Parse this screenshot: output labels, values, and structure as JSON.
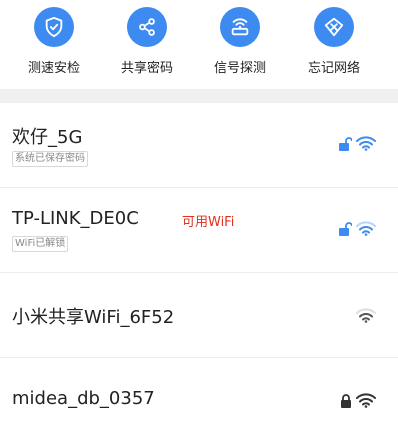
{
  "actions": [
    {
      "label": "测速安检",
      "icon": "shield-check-icon"
    },
    {
      "label": "共享密码",
      "icon": "share-icon"
    },
    {
      "label": "信号探测",
      "icon": "router-signal-icon"
    },
    {
      "label": "忘记网络",
      "icon": "tag-forget-icon"
    }
  ],
  "networks": [
    {
      "ssid": "欢仔_5G",
      "tag": "系统已保存密码",
      "hint": "",
      "lock": "open",
      "signal": "strong",
      "color": "#3d8bf0"
    },
    {
      "ssid": "TP-LINK_DE0C",
      "tag": "WiFi已解锁",
      "hint": "可用WiFi",
      "lock": "open",
      "signal": "strong",
      "color": "#3d8bf0"
    },
    {
      "ssid": "小米共享WiFi_6F52",
      "tag": "",
      "hint": "",
      "lock": "none",
      "signal": "weak",
      "color": "#555555"
    },
    {
      "ssid": "midea_db_0357",
      "tag": "",
      "hint": "",
      "lock": "closed",
      "signal": "strong",
      "color": "#333333"
    }
  ],
  "colors": {
    "accent": "#3d8bf0",
    "hint": "#e0301e"
  }
}
